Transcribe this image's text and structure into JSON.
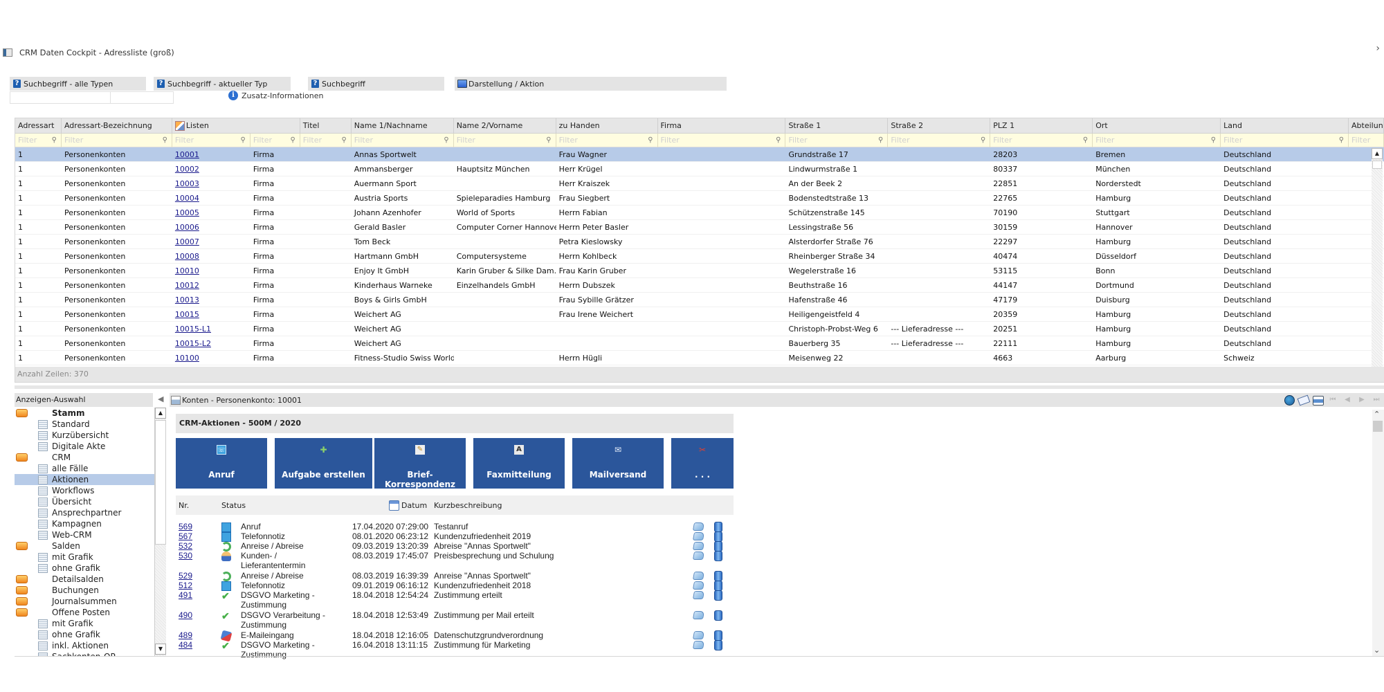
{
  "window": {
    "title": "CRM Daten Cockpit - Adressliste (groß)",
    "collapse_glyph": "›"
  },
  "search": {
    "groups": [
      {
        "label": "Suchbegriff - alle Typen",
        "icon": "help-icon"
      },
      {
        "label": "Suchbegriff - aktueller Typ",
        "icon": "help-icon"
      },
      {
        "label": "Suchbegriff",
        "icon": "help-icon"
      },
      {
        "label": "Darstellung / Aktion",
        "icon": "monitor-icon"
      }
    ],
    "input_values": [
      "",
      ""
    ],
    "zusatz_label": "Zusatz-Informationen"
  },
  "grid": {
    "columns": [
      "Adressart",
      "Adressart-Bezeichnung",
      "Listen",
      "",
      "Titel",
      "Name 1/Nachname",
      "Name 2/Vorname",
      "zu Handen",
      "Firma",
      "Straße 1",
      "Straße 2",
      "PLZ 1",
      "Ort",
      "Land",
      "Abteilung"
    ],
    "filter_placeholder": "Filter",
    "filter_icon": "🔍",
    "rows": [
      {
        "adressart": "1",
        "bez": "Personenkonten",
        "konto": "10001",
        "typ": "Firma",
        "titel": "",
        "name1": "Annas Sportwelt",
        "name2": "",
        "zuhanden": "Frau Wagner",
        "firma": "",
        "strasse1": "Grundstraße 17",
        "strasse2": "",
        "plz": "28203",
        "ort": "Bremen",
        "land": "Deutschland",
        "abteilung": ""
      },
      {
        "adressart": "1",
        "bez": "Personenkonten",
        "konto": "10002",
        "typ": "Firma",
        "titel": "",
        "name1": "Ammansberger",
        "name2": "Hauptsitz München",
        "zuhanden": "Herr Krügel",
        "firma": "",
        "strasse1": "Lindwurmstraße 1",
        "strasse2": "",
        "plz": "80337",
        "ort": "München",
        "land": "Deutschland",
        "abteilung": ""
      },
      {
        "adressart": "1",
        "bez": "Personenkonten",
        "konto": "10003",
        "typ": "Firma",
        "titel": "",
        "name1": "Auermann Sport",
        "name2": "",
        "zuhanden": "Herr Kraiszek",
        "firma": "",
        "strasse1": "An der Beek 2",
        "strasse2": "",
        "plz": "22851",
        "ort": "Norderstedt",
        "land": "Deutschland",
        "abteilung": ""
      },
      {
        "adressart": "1",
        "bez": "Personenkonten",
        "konto": "10004",
        "typ": "Firma",
        "titel": "",
        "name1": "Austria Sports",
        "name2": "Spieleparadies Hamburg",
        "zuhanden": "Frau Siegbert",
        "firma": "",
        "strasse1": "Bodenstedtstraße 13",
        "strasse2": "",
        "plz": "22765",
        "ort": "Hamburg",
        "land": "Deutschland",
        "abteilung": ""
      },
      {
        "adressart": "1",
        "bez": "Personenkonten",
        "konto": "10005",
        "typ": "Firma",
        "titel": "",
        "name1": "Johann Azenhofer",
        "name2": "World of Sports",
        "zuhanden": "Herrn Fabian",
        "firma": "",
        "strasse1": "Schützenstraße 145",
        "strasse2": "",
        "plz": "70190",
        "ort": "Stuttgart",
        "land": "Deutschland",
        "abteilung": ""
      },
      {
        "adressart": "1",
        "bez": "Personenkonten",
        "konto": "10006",
        "typ": "Firma",
        "titel": "",
        "name1": "Gerald Basler",
        "name2": "Computer Corner Hannover",
        "zuhanden": "Herrn Peter Basler",
        "firma": "",
        "strasse1": "Lessingstraße 56",
        "strasse2": "",
        "plz": "30159",
        "ort": "Hannover",
        "land": "Deutschland",
        "abteilung": ""
      },
      {
        "adressart": "1",
        "bez": "Personenkonten",
        "konto": "10007",
        "typ": "Firma",
        "titel": "",
        "name1": "Tom Beck",
        "name2": "",
        "zuhanden": "Petra Kieslowsky",
        "firma": "",
        "strasse1": "Alsterdorfer Straße 76",
        "strasse2": "",
        "plz": "22297",
        "ort": "Hamburg",
        "land": "Deutschland",
        "abteilung": ""
      },
      {
        "adressart": "1",
        "bez": "Personenkonten",
        "konto": "10008",
        "typ": "Firma",
        "titel": "",
        "name1": "Hartmann GmbH",
        "name2": "Computersysteme",
        "zuhanden": "Herrn Kohlbeck",
        "firma": "",
        "strasse1": "Rheinberger Straße 34",
        "strasse2": "",
        "plz": "40474",
        "ort": "Düsseldorf",
        "land": "Deutschland",
        "abteilung": ""
      },
      {
        "adressart": "1",
        "bez": "Personenkonten",
        "konto": "10010",
        "typ": "Firma",
        "titel": "",
        "name1": "Enjoy It GmbH",
        "name2": "Karin Gruber & Silke Dam...",
        "zuhanden": "Frau Karin Gruber",
        "firma": "",
        "strasse1": "Wegelerstraße 16",
        "strasse2": "",
        "plz": "53115",
        "ort": "Bonn",
        "land": "Deutschland",
        "abteilung": ""
      },
      {
        "adressart": "1",
        "bez": "Personenkonten",
        "konto": "10012",
        "typ": "Firma",
        "titel": "",
        "name1": "Kinderhaus Warneke",
        "name2": "Einzelhandels GmbH",
        "zuhanden": "Herrn Dubszek",
        "firma": "",
        "strasse1": "Beuthstraße 16",
        "strasse2": "",
        "plz": "44147",
        "ort": "Dortmund",
        "land": "Deutschland",
        "abteilung": ""
      },
      {
        "adressart": "1",
        "bez": "Personenkonten",
        "konto": "10013",
        "typ": "Firma",
        "titel": "",
        "name1": "Boys & Girls GmbH",
        "name2": "",
        "zuhanden": "Frau Sybille Grätzer",
        "firma": "",
        "strasse1": "Hafenstraße 46",
        "strasse2": "",
        "plz": "47179",
        "ort": "Duisburg",
        "land": "Deutschland",
        "abteilung": ""
      },
      {
        "adressart": "1",
        "bez": "Personenkonten",
        "konto": "10015",
        "typ": "Firma",
        "titel": "",
        "name1": "Weichert AG",
        "name2": "",
        "zuhanden": "Frau Irene Weichert",
        "firma": "",
        "strasse1": "Heiligengeistfeld 4",
        "strasse2": "",
        "plz": "20359",
        "ort": "Hamburg",
        "land": "Deutschland",
        "abteilung": ""
      },
      {
        "adressart": "1",
        "bez": "Personenkonten",
        "konto": "10015-L1",
        "typ": "Firma",
        "titel": "",
        "name1": "Weichert AG",
        "name2": "",
        "zuhanden": "",
        "firma": "",
        "strasse1": "Christoph-Probst-Weg 6",
        "strasse2": "--- Lieferadresse ---",
        "plz": "20251",
        "ort": "Hamburg",
        "land": "Deutschland",
        "abteilung": ""
      },
      {
        "adressart": "1",
        "bez": "Personenkonten",
        "konto": "10015-L2",
        "typ": "Firma",
        "titel": "",
        "name1": "Weichert AG",
        "name2": "",
        "zuhanden": "",
        "firma": "",
        "strasse1": "Bauerberg 35",
        "strasse2": "--- Lieferadresse ---",
        "plz": "22111",
        "ort": "Hamburg",
        "land": "Deutschland",
        "abteilung": ""
      },
      {
        "adressart": "1",
        "bez": "Personenkonten",
        "konto": "10100",
        "typ": "Firma",
        "titel": "",
        "name1": "Fitness-Studio Swiss World",
        "name2": "",
        "zuhanden": "Herrn Hügli",
        "firma": "",
        "strasse1": "Meisenweg 22",
        "strasse2": "",
        "plz": "4663",
        "ort": "Aarburg",
        "land": "Schweiz",
        "abteilung": ""
      }
    ],
    "selected_row": 0,
    "footer": "Anzahl Zeilen: 370"
  },
  "sidebar": {
    "title": "Anzeigen-Auswahl",
    "items": [
      {
        "label": "Stamm",
        "type": "folder",
        "bold": true
      },
      {
        "label": "Standard",
        "type": "doc"
      },
      {
        "label": "Kurzübersicht",
        "type": "doc"
      },
      {
        "label": "Digitale Akte",
        "type": "doc"
      },
      {
        "label": "CRM",
        "type": "folder"
      },
      {
        "label": "alle Fälle",
        "type": "doc"
      },
      {
        "label": "Aktionen",
        "type": "doc",
        "selected": true
      },
      {
        "label": "Workflows",
        "type": "doc"
      },
      {
        "label": "Übersicht",
        "type": "doc"
      },
      {
        "label": "Ansprechpartner",
        "type": "doc"
      },
      {
        "label": "Kampagnen",
        "type": "doc"
      },
      {
        "label": "Web-CRM",
        "type": "doc"
      },
      {
        "label": "Salden",
        "type": "folder"
      },
      {
        "label": "mit Grafik",
        "type": "doc"
      },
      {
        "label": "ohne Grafik",
        "type": "doc"
      },
      {
        "label": "Detailsalden",
        "type": "folder"
      },
      {
        "label": "Buchungen",
        "type": "folder"
      },
      {
        "label": "Journalsummen",
        "type": "folder"
      },
      {
        "label": "Offene Posten",
        "type": "folder"
      },
      {
        "label": "mit Grafik",
        "type": "doc"
      },
      {
        "label": "ohne Grafik",
        "type": "doc"
      },
      {
        "label": "inkl. Aktionen",
        "type": "doc"
      },
      {
        "label": "Sachkonten-OP",
        "type": "doc"
      }
    ]
  },
  "detail": {
    "breadcrumb": "Konten - Personenkonto: 10001",
    "tools": [
      "globe-icon",
      "mail-icon",
      "print-icon",
      "first-icon",
      "prev-icon",
      "next-icon",
      "last-icon"
    ],
    "crm_title": "CRM-Aktionen - 500M / 2020",
    "action_buttons": [
      {
        "label": "Anruf",
        "icon": "☏"
      },
      {
        "label": "Aufgabe erstellen",
        "icon": "✚"
      },
      {
        "label": "Brief-Korrespondenz",
        "icon": "✎"
      },
      {
        "label": "Faxmitteilung",
        "icon": "A"
      },
      {
        "label": "Mailversand",
        "icon": "✉"
      },
      {
        "label": ". . .",
        "icon": "✂"
      }
    ],
    "actions_header": {
      "nr": "Nr.",
      "status": "Status",
      "datum": "Datum",
      "kurz": "Kurzbeschreibung"
    },
    "actions": [
      {
        "nr": "569",
        "icon": "phone",
        "status": "Anruf",
        "datum": "17.04.2020 07:29:00",
        "kurz": "Testanruf",
        "lines": 1
      },
      {
        "nr": "567",
        "icon": "phone",
        "status": "Telefonnotiz",
        "datum": "08.01.2020 06:23:12",
        "kurz": "Kundenzufriedenheit 2019",
        "lines": 1
      },
      {
        "nr": "532",
        "icon": "cycle",
        "status": "Anreise / Abreise",
        "datum": "09.03.2019 13:20:39",
        "kurz": "Abreise \"Annas Sportwelt\"",
        "lines": 1
      },
      {
        "nr": "530",
        "icon": "person",
        "status": "Kunden- / Lieferantentermin",
        "datum": "08.03.2019 17:45:07",
        "kurz": "Preisbesprechung und Schulung",
        "lines": 2
      },
      {
        "nr": "529",
        "icon": "cycle",
        "status": "Anreise / Abreise",
        "datum": "08.03.2019 16:39:39",
        "kurz": "Anreise \"Annas Sportwelt\"",
        "lines": 1
      },
      {
        "nr": "512",
        "icon": "phone",
        "status": "Telefonnotiz",
        "datum": "09.01.2019 06:16:12",
        "kurz": "Kundenzufriedenheit 2018",
        "lines": 1
      },
      {
        "nr": "491",
        "icon": "check",
        "status": "DSGVO Marketing - Zustimmung",
        "datum": "18.04.2018 12:54:24",
        "kurz": "Zustimmung erteilt",
        "lines": 2
      },
      {
        "nr": "490",
        "icon": "check",
        "status": "DSGVO Verarbeitung - Zustimmung",
        "datum": "18.04.2018 12:53:49",
        "kurz": "Zustimmung per Mail erteilt",
        "lines": 2
      },
      {
        "nr": "489",
        "icon": "email",
        "status": "E-Maileingang",
        "datum": "18.04.2018 12:16:05",
        "kurz": "Datenschutzgrundverordnung",
        "lines": 1
      },
      {
        "nr": "484",
        "icon": "check",
        "status": "DSGVO Marketing - Zustimmung",
        "datum": "16.04.2018 13:11:15",
        "kurz": "Zustimmung für Marketing",
        "lines": 2
      }
    ]
  },
  "colors": {
    "selection": "#b7cbe8",
    "action_button": "#2b569b",
    "filter_bg": "#fffde0",
    "header_bg": "#e6e6e6",
    "link": "#1a1a8c"
  }
}
